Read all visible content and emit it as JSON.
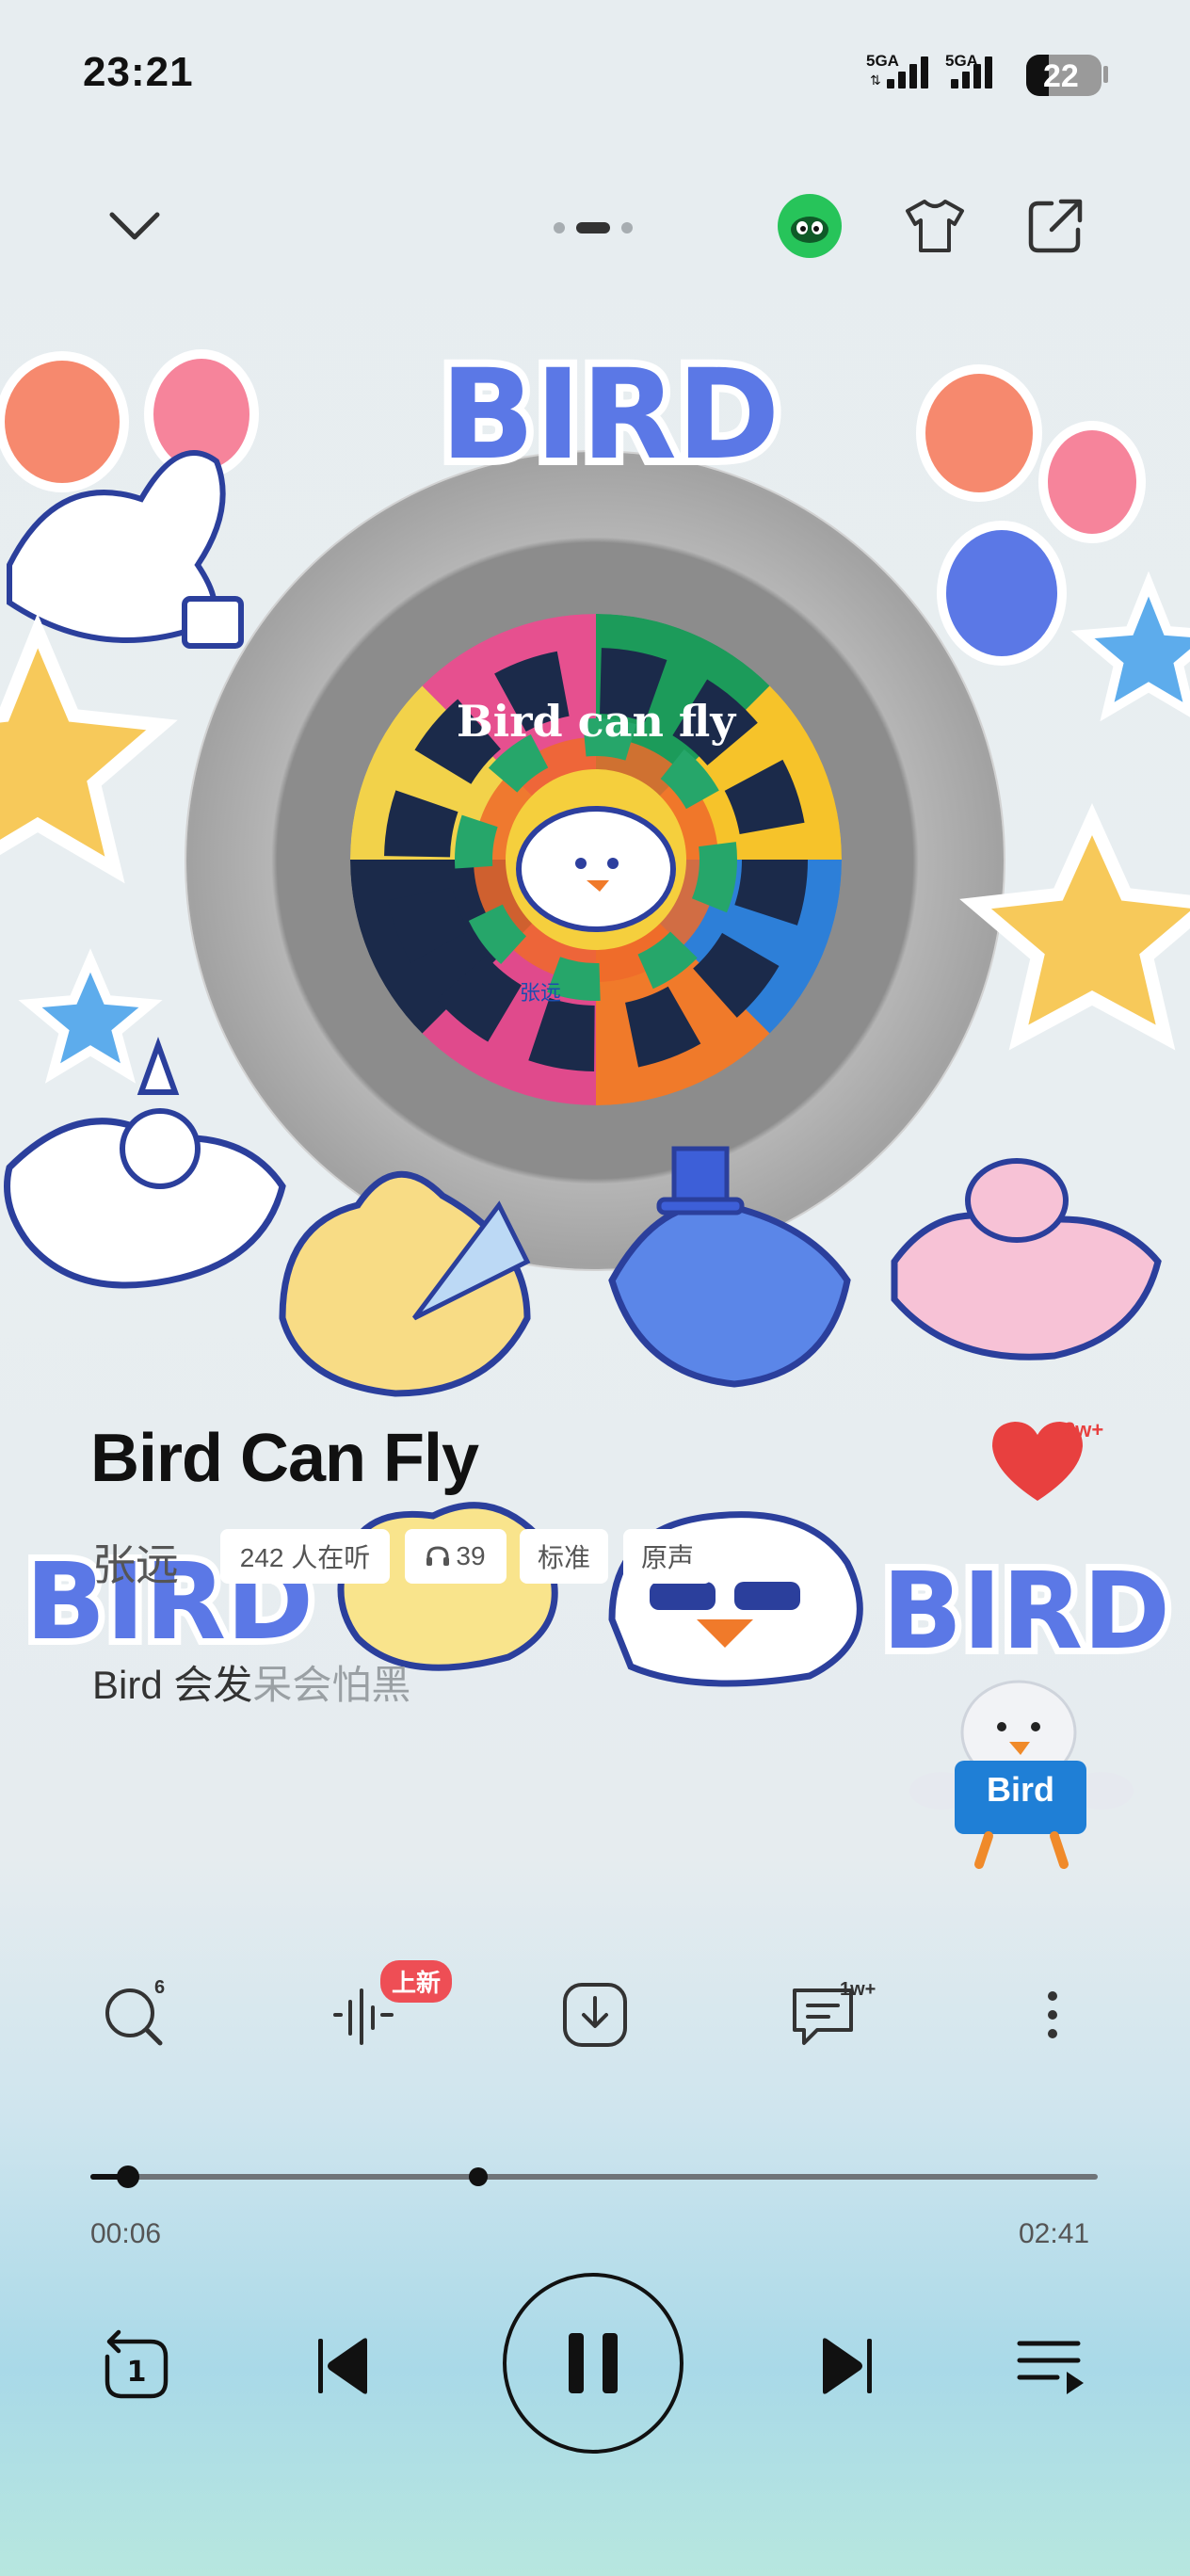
{
  "status_bar": {
    "time": "23:21",
    "network_1": "5GA",
    "network_2": "5GA",
    "battery": "22"
  },
  "top_bar": {
    "pages": 3,
    "active_page": 2
  },
  "artwork": {
    "sticker_text": "BIRD",
    "label_title": "Bird can fly",
    "label_artist": "张远",
    "mascot_sign": "Bird"
  },
  "song": {
    "title": "Bird Can Fly",
    "artist": "张远",
    "like_count": "2w+",
    "tags": {
      "listening": "242 人在听",
      "listening_icon": "headphones-icon",
      "headphones_count": "39",
      "quality": "标准",
      "version": "原声"
    }
  },
  "lyric": {
    "sung": "Bird 会发",
    "unsung": "呆会怕黑"
  },
  "actions": {
    "search_count": "6",
    "effects_badge": "上新",
    "comments_count": "1w+"
  },
  "progress": {
    "elapsed": "00:06",
    "duration": "02:41",
    "fraction": 0.037
  },
  "controls": {
    "repeat_count": "1"
  },
  "colors": {
    "heart": "#e8403f",
    "badge": "#ee4e55",
    "sticker_blue": "#4f6fe0"
  }
}
